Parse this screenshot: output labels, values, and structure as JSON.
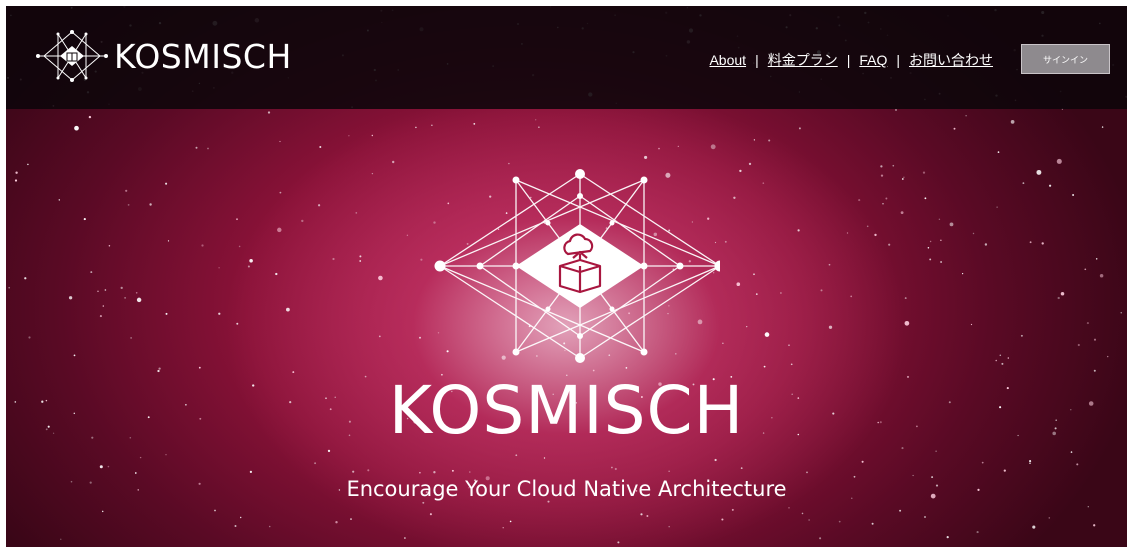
{
  "header": {
    "brand_name": "KOSMISCH",
    "nav": {
      "about": "About",
      "pricing": "料金プラン",
      "faq": "FAQ",
      "contact": "お問い合わせ",
      "separator": "|"
    },
    "signin_label": "サインイン"
  },
  "hero": {
    "title": "KOSMISCH",
    "tagline": "Encourage Your Cloud Native Architecture"
  },
  "colors": {
    "accent": "#a8163f",
    "header_bg": "#0c060a",
    "signin_bg": "#8e8a8e"
  },
  "icons": {
    "brand": "cosmic-network-logo-icon",
    "hero": "cloud-box-network-icon"
  }
}
